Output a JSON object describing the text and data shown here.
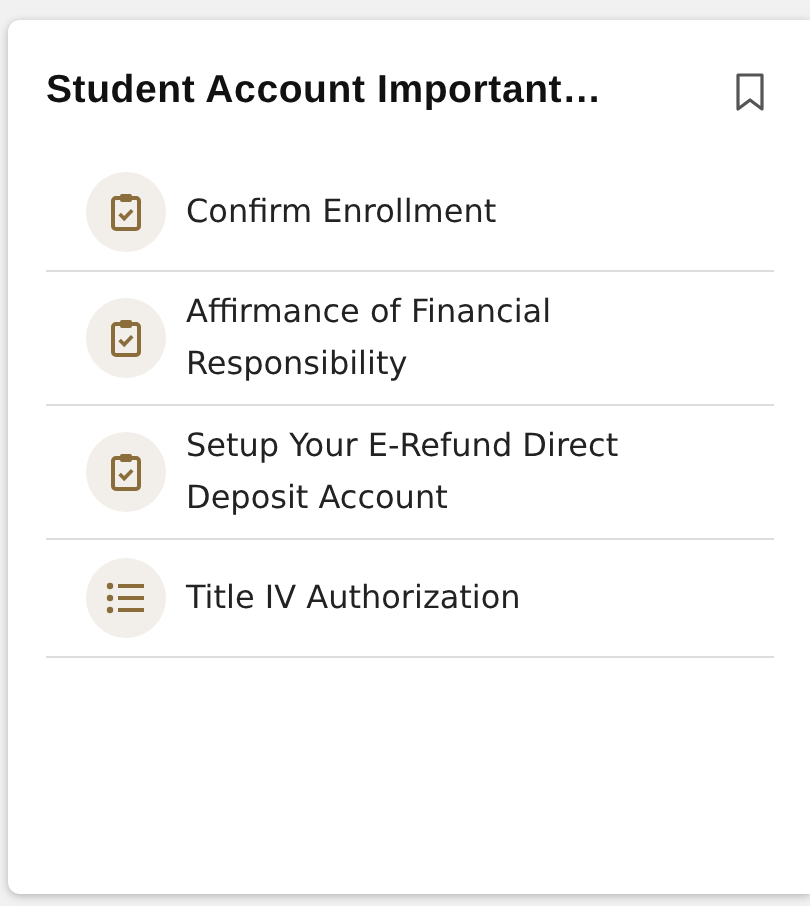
{
  "card": {
    "title": "Student Account Important…"
  },
  "items": [
    {
      "label": "Confirm Enrollment",
      "kind": "task"
    },
    {
      "label": "Affirmance of Financial Responsibility",
      "kind": "task"
    },
    {
      "label": "Setup Your E-Refund Direct Deposit Account",
      "kind": "task"
    },
    {
      "label": "Title IV Authorization",
      "kind": "list"
    }
  ]
}
